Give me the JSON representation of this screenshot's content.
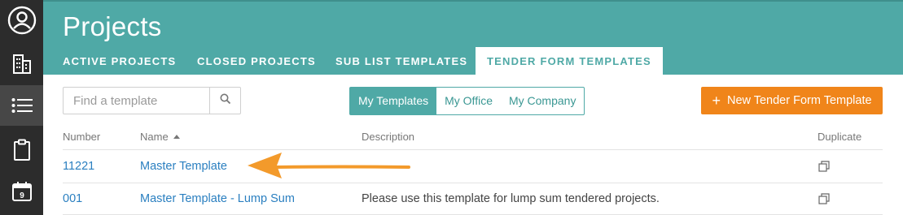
{
  "rail": {
    "items": [
      {
        "icon": "user-circle-icon"
      },
      {
        "icon": "building-icon"
      },
      {
        "icon": "list-icon",
        "active": true
      },
      {
        "icon": "clipboard-icon"
      },
      {
        "icon": "calendar-icon",
        "badge": "9"
      }
    ]
  },
  "header": {
    "title": "Projects",
    "tabs": [
      {
        "label": "ACTIVE PROJECTS"
      },
      {
        "label": "CLOSED PROJECTS"
      },
      {
        "label": "SUB LIST TEMPLATES"
      },
      {
        "label": "TENDER FORM TEMPLATES",
        "selected": true
      }
    ]
  },
  "toolbar": {
    "search_placeholder": "Find a template",
    "filters": [
      {
        "label": "My Templates",
        "selected": true
      },
      {
        "label": "My Office"
      },
      {
        "label": "My Company"
      }
    ],
    "new_button_plus": "+",
    "new_button_label": "New Tender Form Template"
  },
  "table": {
    "columns": {
      "number": "Number",
      "name": "Name",
      "description": "Description",
      "duplicate": "Duplicate"
    },
    "sorted_column": "name",
    "rows": [
      {
        "number": "11221",
        "name": "Master Template",
        "description": "--"
      },
      {
        "number": "001",
        "name": "Master Template - Lump Sum",
        "description": "Please use this template for lump sum tendered projects."
      }
    ]
  },
  "colors": {
    "teal": "#4fa9a6",
    "orange": "#f0851a",
    "link": "#2a7fc0",
    "rail": "#2c2c2c"
  }
}
